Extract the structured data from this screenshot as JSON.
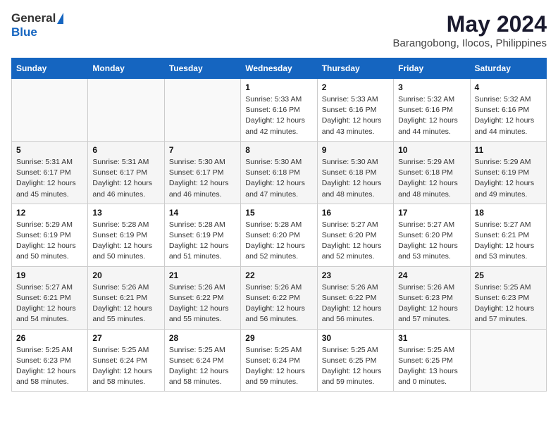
{
  "header": {
    "logo_general": "General",
    "logo_blue": "Blue",
    "title": "May 2024",
    "subtitle": "Barangobong, Ilocos, Philippines"
  },
  "weekdays": [
    "Sunday",
    "Monday",
    "Tuesday",
    "Wednesday",
    "Thursday",
    "Friday",
    "Saturday"
  ],
  "weeks": [
    {
      "days": [
        {
          "num": "",
          "info": ""
        },
        {
          "num": "",
          "info": ""
        },
        {
          "num": "",
          "info": ""
        },
        {
          "num": "1",
          "info": "Sunrise: 5:33 AM\nSunset: 6:16 PM\nDaylight: 12 hours and 42 minutes."
        },
        {
          "num": "2",
          "info": "Sunrise: 5:33 AM\nSunset: 6:16 PM\nDaylight: 12 hours and 43 minutes."
        },
        {
          "num": "3",
          "info": "Sunrise: 5:32 AM\nSunset: 6:16 PM\nDaylight: 12 hours and 44 minutes."
        },
        {
          "num": "4",
          "info": "Sunrise: 5:32 AM\nSunset: 6:16 PM\nDaylight: 12 hours and 44 minutes."
        }
      ]
    },
    {
      "days": [
        {
          "num": "5",
          "info": "Sunrise: 5:31 AM\nSunset: 6:17 PM\nDaylight: 12 hours and 45 minutes."
        },
        {
          "num": "6",
          "info": "Sunrise: 5:31 AM\nSunset: 6:17 PM\nDaylight: 12 hours and 46 minutes."
        },
        {
          "num": "7",
          "info": "Sunrise: 5:30 AM\nSunset: 6:17 PM\nDaylight: 12 hours and 46 minutes."
        },
        {
          "num": "8",
          "info": "Sunrise: 5:30 AM\nSunset: 6:18 PM\nDaylight: 12 hours and 47 minutes."
        },
        {
          "num": "9",
          "info": "Sunrise: 5:30 AM\nSunset: 6:18 PM\nDaylight: 12 hours and 48 minutes."
        },
        {
          "num": "10",
          "info": "Sunrise: 5:29 AM\nSunset: 6:18 PM\nDaylight: 12 hours and 48 minutes."
        },
        {
          "num": "11",
          "info": "Sunrise: 5:29 AM\nSunset: 6:19 PM\nDaylight: 12 hours and 49 minutes."
        }
      ]
    },
    {
      "days": [
        {
          "num": "12",
          "info": "Sunrise: 5:29 AM\nSunset: 6:19 PM\nDaylight: 12 hours and 50 minutes."
        },
        {
          "num": "13",
          "info": "Sunrise: 5:28 AM\nSunset: 6:19 PM\nDaylight: 12 hours and 50 minutes."
        },
        {
          "num": "14",
          "info": "Sunrise: 5:28 AM\nSunset: 6:19 PM\nDaylight: 12 hours and 51 minutes."
        },
        {
          "num": "15",
          "info": "Sunrise: 5:28 AM\nSunset: 6:20 PM\nDaylight: 12 hours and 52 minutes."
        },
        {
          "num": "16",
          "info": "Sunrise: 5:27 AM\nSunset: 6:20 PM\nDaylight: 12 hours and 52 minutes."
        },
        {
          "num": "17",
          "info": "Sunrise: 5:27 AM\nSunset: 6:20 PM\nDaylight: 12 hours and 53 minutes."
        },
        {
          "num": "18",
          "info": "Sunrise: 5:27 AM\nSunset: 6:21 PM\nDaylight: 12 hours and 53 minutes."
        }
      ]
    },
    {
      "days": [
        {
          "num": "19",
          "info": "Sunrise: 5:27 AM\nSunset: 6:21 PM\nDaylight: 12 hours and 54 minutes."
        },
        {
          "num": "20",
          "info": "Sunrise: 5:26 AM\nSunset: 6:21 PM\nDaylight: 12 hours and 55 minutes."
        },
        {
          "num": "21",
          "info": "Sunrise: 5:26 AM\nSunset: 6:22 PM\nDaylight: 12 hours and 55 minutes."
        },
        {
          "num": "22",
          "info": "Sunrise: 5:26 AM\nSunset: 6:22 PM\nDaylight: 12 hours and 56 minutes."
        },
        {
          "num": "23",
          "info": "Sunrise: 5:26 AM\nSunset: 6:22 PM\nDaylight: 12 hours and 56 minutes."
        },
        {
          "num": "24",
          "info": "Sunrise: 5:26 AM\nSunset: 6:23 PM\nDaylight: 12 hours and 57 minutes."
        },
        {
          "num": "25",
          "info": "Sunrise: 5:25 AM\nSunset: 6:23 PM\nDaylight: 12 hours and 57 minutes."
        }
      ]
    },
    {
      "days": [
        {
          "num": "26",
          "info": "Sunrise: 5:25 AM\nSunset: 6:23 PM\nDaylight: 12 hours and 58 minutes."
        },
        {
          "num": "27",
          "info": "Sunrise: 5:25 AM\nSunset: 6:24 PM\nDaylight: 12 hours and 58 minutes."
        },
        {
          "num": "28",
          "info": "Sunrise: 5:25 AM\nSunset: 6:24 PM\nDaylight: 12 hours and 58 minutes."
        },
        {
          "num": "29",
          "info": "Sunrise: 5:25 AM\nSunset: 6:24 PM\nDaylight: 12 hours and 59 minutes."
        },
        {
          "num": "30",
          "info": "Sunrise: 5:25 AM\nSunset: 6:25 PM\nDaylight: 12 hours and 59 minutes."
        },
        {
          "num": "31",
          "info": "Sunrise: 5:25 AM\nSunset: 6:25 PM\nDaylight: 13 hours and 0 minutes."
        },
        {
          "num": "",
          "info": ""
        }
      ]
    }
  ]
}
